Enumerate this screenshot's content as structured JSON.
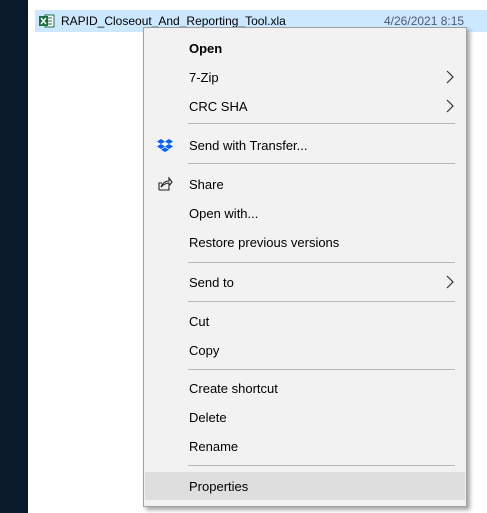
{
  "file": {
    "name": "RAPID_Closeout_And_Reporting_Tool.xla",
    "date": "4/26/2021 8:15"
  },
  "menu": {
    "open": "Open",
    "zip": "7-Zip",
    "crc": "CRC SHA",
    "send_transfer": "Send with Transfer...",
    "share": "Share",
    "open_with": "Open with...",
    "restore": "Restore previous versions",
    "send_to": "Send to",
    "cut": "Cut",
    "copy": "Copy",
    "create_shortcut": "Create shortcut",
    "delete": "Delete",
    "rename": "Rename",
    "properties": "Properties"
  },
  "colors": {
    "selection": "#cce8ff",
    "menu_bg": "#f2f2f2",
    "hover": "#dedede",
    "dropbox_blue": "#0061fe",
    "excel_green": "#1d6f42"
  },
  "icons": {
    "file": "excel-file-icon",
    "transfer": "dropbox-icon",
    "share": "share-icon",
    "submenu": "chevron-right-icon"
  }
}
